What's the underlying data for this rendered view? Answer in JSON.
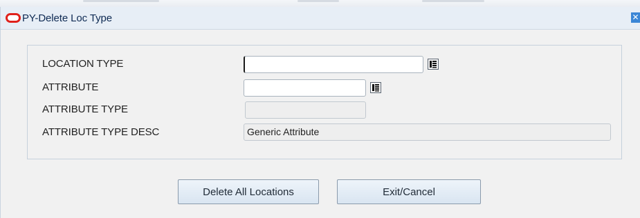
{
  "window": {
    "title": "PY-Delete Loc Type",
    "close_symbol": "✕",
    "logo_icon": "oracle-logo-icon",
    "close_icon": "close-icon"
  },
  "form": {
    "fields": [
      {
        "label": "LOCATION TYPE",
        "value": "",
        "editable": true,
        "has_lov": true
      },
      {
        "label": "ATTRIBUTE",
        "value": "",
        "editable": true,
        "has_lov": true
      },
      {
        "label": "ATTRIBUTE TYPE",
        "value": "",
        "editable": false,
        "has_lov": false
      },
      {
        "label": "ATTRIBUTE TYPE DESC",
        "value": "Generic Attribute",
        "editable": false,
        "has_lov": false
      }
    ],
    "lov_icon": "list-of-values-icon"
  },
  "buttons": {
    "delete_all_label": "Delete All Locations",
    "exit_cancel_label": "Exit/Cancel"
  },
  "colors": {
    "title_bar": "#e7eef6",
    "title_text": "#0e2a53",
    "logo_red": "#e0211b",
    "close_blue": "#3b86d6",
    "background": "#f1f1f1"
  }
}
